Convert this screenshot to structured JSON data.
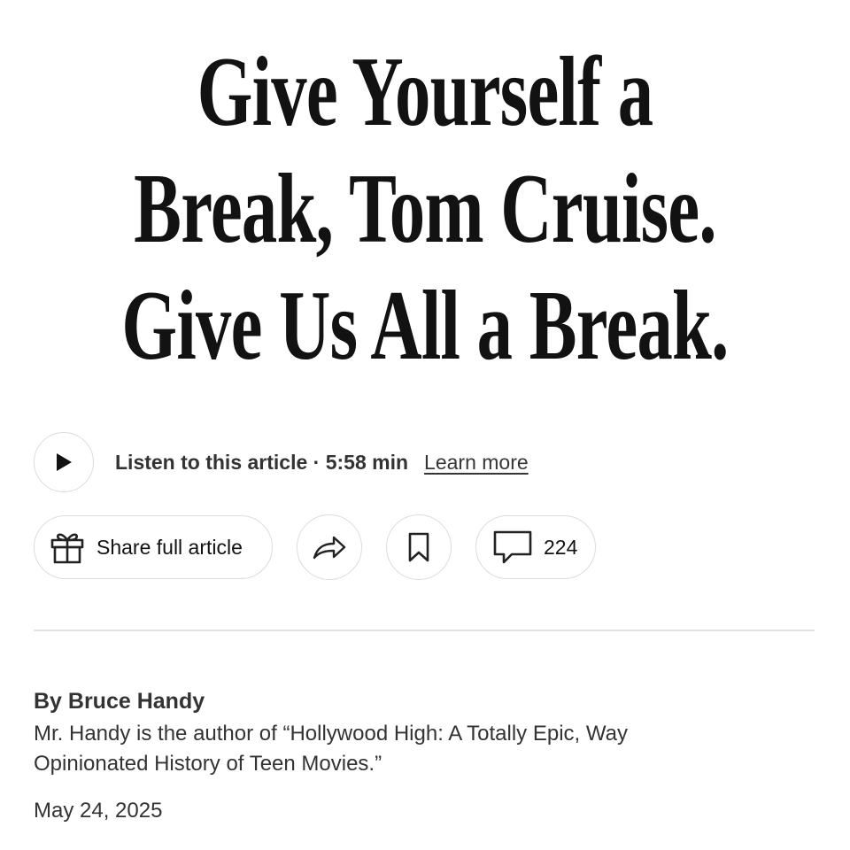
{
  "headline": {
    "line1": "Give Yourself a",
    "line2": "Break, Tom Cruise.",
    "line3": "Give Us All a Break."
  },
  "audio": {
    "listen_label": "Listen to this article · 5:58 min",
    "learn_more": "Learn more",
    "play_icon": "play-icon"
  },
  "actions": {
    "share_full_label": "Share full article",
    "gift_icon": "gift-icon",
    "share_icon": "share-arrow-icon",
    "bookmark_icon": "bookmark-icon",
    "comment_icon": "comment-icon",
    "comment_count": "224"
  },
  "byline": {
    "author": "By Bruce Handy",
    "bio": "Mr. Handy is the author of “Hollywood High: A Totally Epic, Way Opinionated History of Teen Movies.”",
    "date": "May 24, 2025"
  },
  "colors": {
    "text": "#121212",
    "border": "#dcdcdc",
    "divider": "#e2e2e2"
  }
}
